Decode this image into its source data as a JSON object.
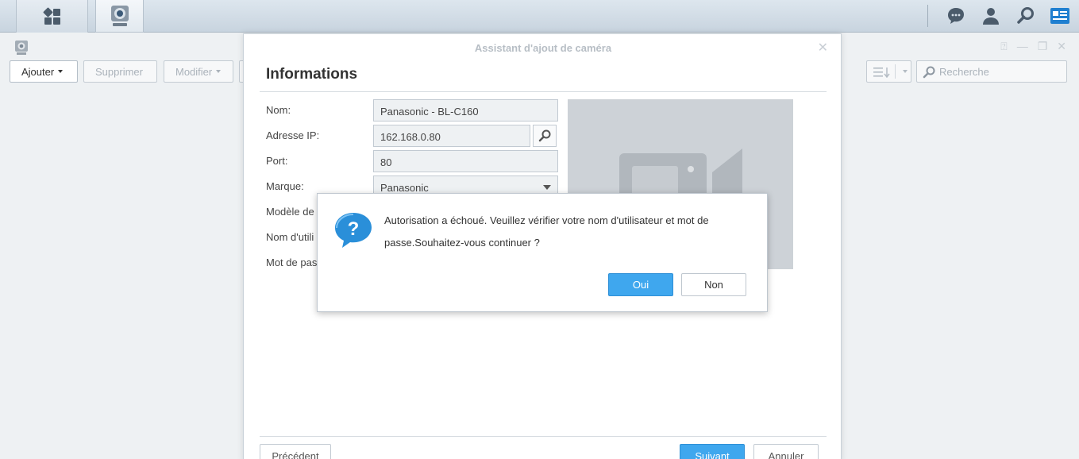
{
  "taskbar": {
    "main_menu_icon": "grid-icon",
    "active_app_icon": "surveillance-camera-icon",
    "right_icons": [
      "chat-icon",
      "user-icon",
      "search-icon",
      "widgets-icon"
    ]
  },
  "app": {
    "toolbar": {
      "add_label": "Ajouter",
      "delete_label": "Supprimer",
      "edit_label": "Modifier"
    },
    "search": {
      "placeholder": "Recherche"
    }
  },
  "wizard": {
    "window_title": "Assistant d'ajout de caméra",
    "section_title": "Informations",
    "labels": {
      "name": "Nom:",
      "ip": "Adresse IP:",
      "port": "Port:",
      "brand": "Marque:",
      "model": "Modèle de",
      "username": "Nom d'utili",
      "password": "Mot de pas"
    },
    "values": {
      "name": "Panasonic - BL-C160",
      "ip": "162.168.0.80",
      "port": "80",
      "brand": "Panasonic"
    },
    "buttons": {
      "previous": "Précédent",
      "next": "Suivant",
      "cancel": "Annuler"
    }
  },
  "dialog": {
    "icon": "question-icon",
    "message_line1": "Autorisation a échoué. Veuillez vérifier votre nom d'utilisateur et mot de",
    "message_line2": "passe.Souhaitez-vous continuer ?",
    "yes_label": "Oui",
    "no_label": "Non"
  },
  "colors": {
    "primary": "#3fa7ee",
    "taskbar": "#d2dce5",
    "question_icon": "#2a8fd9"
  }
}
